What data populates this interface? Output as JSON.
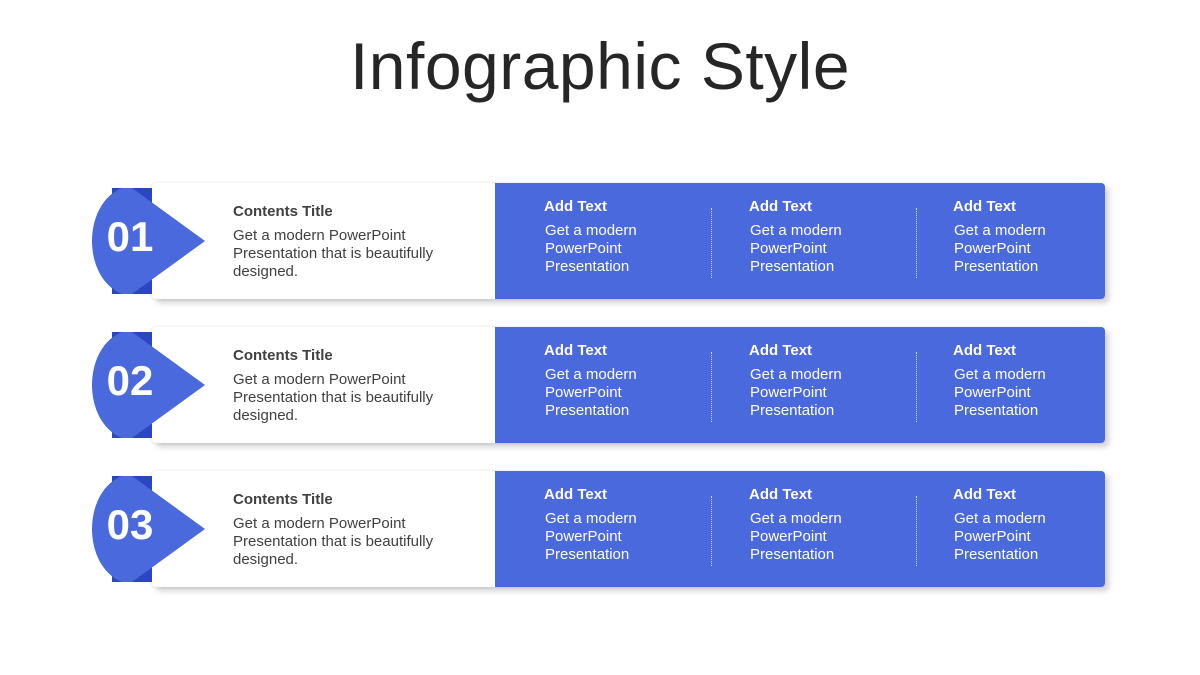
{
  "title": "Infographic Style",
  "colors": {
    "accent": "#4a69dc",
    "accent_dark": "#2b46c0",
    "text_dark": "#404040",
    "title": "#262626"
  },
  "rows": [
    {
      "number": "01",
      "title": "Contents Title",
      "description": "Get a modern PowerPoint Presentation that is beautifully designed.",
      "columns": [
        {
          "title": "Add Text",
          "body": "Get a modern PowerPoint Presentation"
        },
        {
          "title": "Add Text",
          "body": "Get a modern PowerPoint Presentation"
        },
        {
          "title": "Add Text",
          "body": "Get a modern PowerPoint Presentation"
        }
      ]
    },
    {
      "number": "02",
      "title": "Contents Title",
      "description": "Get a modern PowerPoint Presentation that is beautifully designed.",
      "columns": [
        {
          "title": "Add Text",
          "body": "Get a modern PowerPoint Presentation"
        },
        {
          "title": "Add Text",
          "body": "Get a modern PowerPoint Presentation"
        },
        {
          "title": "Add Text",
          "body": "Get a modern PowerPoint Presentation"
        }
      ]
    },
    {
      "number": "03",
      "title": "Contents Title",
      "description": "Get a modern PowerPoint Presentation that is beautifully designed.",
      "columns": [
        {
          "title": "Add Text",
          "body": "Get a modern PowerPoint Presentation"
        },
        {
          "title": "Add Text",
          "body": "Get a modern PowerPoint Presentation"
        },
        {
          "title": "Add Text",
          "body": "Get a modern PowerPoint Presentation"
        }
      ]
    }
  ]
}
